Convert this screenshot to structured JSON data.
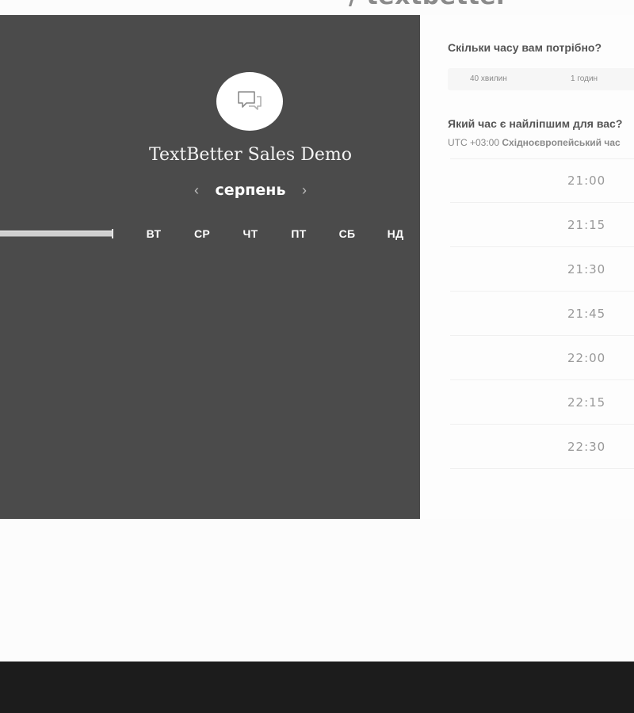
{
  "header": {
    "logo_text": "/ textbetter"
  },
  "calendar": {
    "title": "TextBetter Sales Demo",
    "month": "серпень",
    "prev_arrow": "‹",
    "next_arrow": "›",
    "weekdays": [
      "ВТ",
      "СР",
      "ЧТ",
      "ПТ",
      "СБ",
      "НД"
    ],
    "avatar_icon": "chat-bubbles-icon"
  },
  "booking": {
    "duration_question": "Скільки часу вам потрібно?",
    "durations": [
      "40 хвилин",
      "1 годин"
    ],
    "time_question": "Який час є найліпшим для вас?",
    "timezone_offset": "UTC +03:00",
    "timezone_name": "Східноєвропейський час",
    "slots": [
      "21:00",
      "21:15",
      "21:30",
      "21:45",
      "22:00",
      "22:15",
      "22:30"
    ]
  },
  "colors": {
    "panel_bg": "#4b4b4b",
    "footer_bg": "#1c1c1c",
    "page_bg": "#fcfcfc"
  }
}
